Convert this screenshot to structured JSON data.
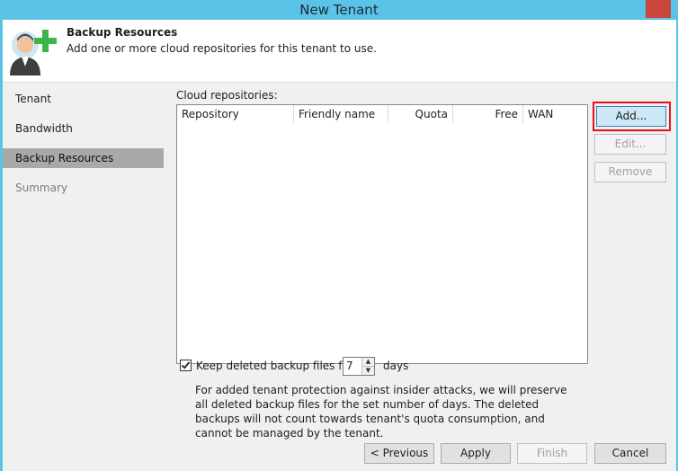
{
  "window": {
    "title": "New Tenant"
  },
  "header": {
    "title": "Backup Resources",
    "subtitle": "Add one or more cloud repositories for this tenant to use."
  },
  "nav": {
    "items": [
      {
        "label": "Tenant"
      },
      {
        "label": "Bandwidth"
      },
      {
        "label": "Backup Resources"
      },
      {
        "label": "Summary"
      }
    ]
  },
  "main": {
    "list_label": "Cloud repositories:",
    "columns": [
      "Repository",
      "Friendly name",
      "Quota",
      "Free",
      "WAN"
    ],
    "buttons": {
      "add": "Add...",
      "edit": "Edit...",
      "remove": "Remove"
    },
    "keep": {
      "label": "Keep deleted backup files for",
      "value": "7",
      "unit": "days",
      "checked": true,
      "description": "For added tenant protection against insider attacks, we will preserve all deleted backup files for the set number of days. The deleted backups will not count towards tenant's quota consumption, and cannot be managed by the tenant."
    }
  },
  "footer": {
    "previous": "< Previous",
    "apply": "Apply",
    "finish": "Finish",
    "cancel": "Cancel"
  }
}
